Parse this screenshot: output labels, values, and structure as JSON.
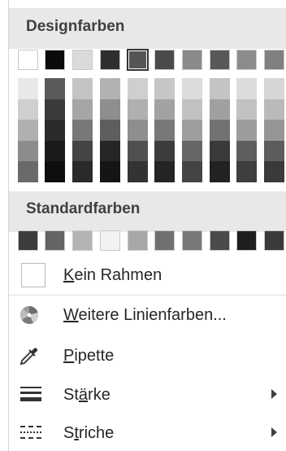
{
  "design_colors": {
    "title": "Designfarben",
    "top_row": [
      "#ffffff",
      "#0a0a0a",
      "#dadada",
      "#2e2e2e",
      "#555555",
      "#4a4a4a",
      "#8a8a8a",
      "#585858",
      "#8c8c8c",
      "#808080"
    ],
    "selected_index": 4,
    "shades": [
      [
        "#e8e8e8",
        "#cfcfcf",
        "#b0b0b0",
        "#8c8c8c",
        "#6a6a6a"
      ],
      [
        "#5a5a5a",
        "#3a3a3a",
        "#2a2a2a",
        "#1a1a1a",
        "#0e0e0e"
      ],
      [
        "#c4c4c4",
        "#a6a6a6",
        "#787878",
        "#444444",
        "#2a2a2a"
      ],
      [
        "#b2b2b2",
        "#8e8e8e",
        "#5e5e5e",
        "#262626",
        "#151515"
      ],
      [
        "#cfcfcf",
        "#b0b0b0",
        "#8e8e8e",
        "#505050",
        "#333333"
      ],
      [
        "#c6c6c6",
        "#a2a2a2",
        "#787878",
        "#3c3c3c",
        "#242424"
      ],
      [
        "#dcdcdc",
        "#c2c2c2",
        "#9e9e9e",
        "#666666",
        "#444444"
      ],
      [
        "#c4c4c4",
        "#a0a0a0",
        "#727272",
        "#3a3a3a",
        "#222222"
      ],
      [
        "#dcdcdc",
        "#c2c2c2",
        "#9c9c9c",
        "#5e5e5e",
        "#3e3e3e"
      ],
      [
        "#d6d6d6",
        "#bababa",
        "#969696",
        "#5c5c5c",
        "#3a3a3a"
      ]
    ]
  },
  "standard_colors": {
    "title": "Standardfarben",
    "swatches": [
      "#3c3c3c",
      "#646464",
      "#b4b4b4",
      "#f2f2f2",
      "#a8a8a8",
      "#707070",
      "#787878",
      "#4a4a4a",
      "#1e1e1e",
      "#3a3a3a"
    ]
  },
  "menu": {
    "no_border": {
      "prefix": "",
      "underlined": "K",
      "suffix": "ein Rahmen"
    },
    "more_colors": {
      "prefix": "",
      "underlined": "W",
      "suffix": "eitere Linienfarben...",
      "icon": "color-wheel-icon"
    },
    "eyedropper": {
      "prefix": "",
      "underlined": "P",
      "suffix": "ipette",
      "icon": "eyedropper-icon"
    },
    "weight": {
      "prefix": "St",
      "underlined": "ä",
      "suffix": "rke",
      "icon": "line-weight-icon"
    },
    "dashes": {
      "prefix": "S",
      "underlined": "t",
      "suffix": "riche",
      "icon": "dash-style-icon"
    }
  }
}
